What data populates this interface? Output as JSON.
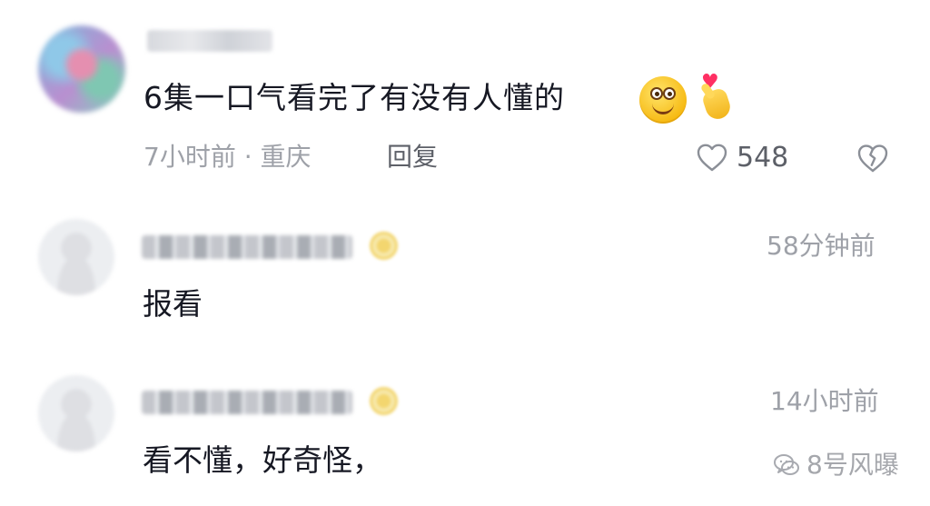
{
  "comment_main": {
    "text": "6集一口气看完了有没有人懂的",
    "meta": "7小时前 · 重庆",
    "reply_label": "回复",
    "like_count": "548",
    "emoji": [
      "smiling-face-icon",
      "finger-heart-icon"
    ]
  },
  "replies": [
    {
      "time": "58分钟前",
      "text": "报看"
    },
    {
      "time": "14小时前",
      "text": "看不懂，好奇怪，"
    }
  ],
  "watermark": {
    "text": "8号风曝"
  }
}
